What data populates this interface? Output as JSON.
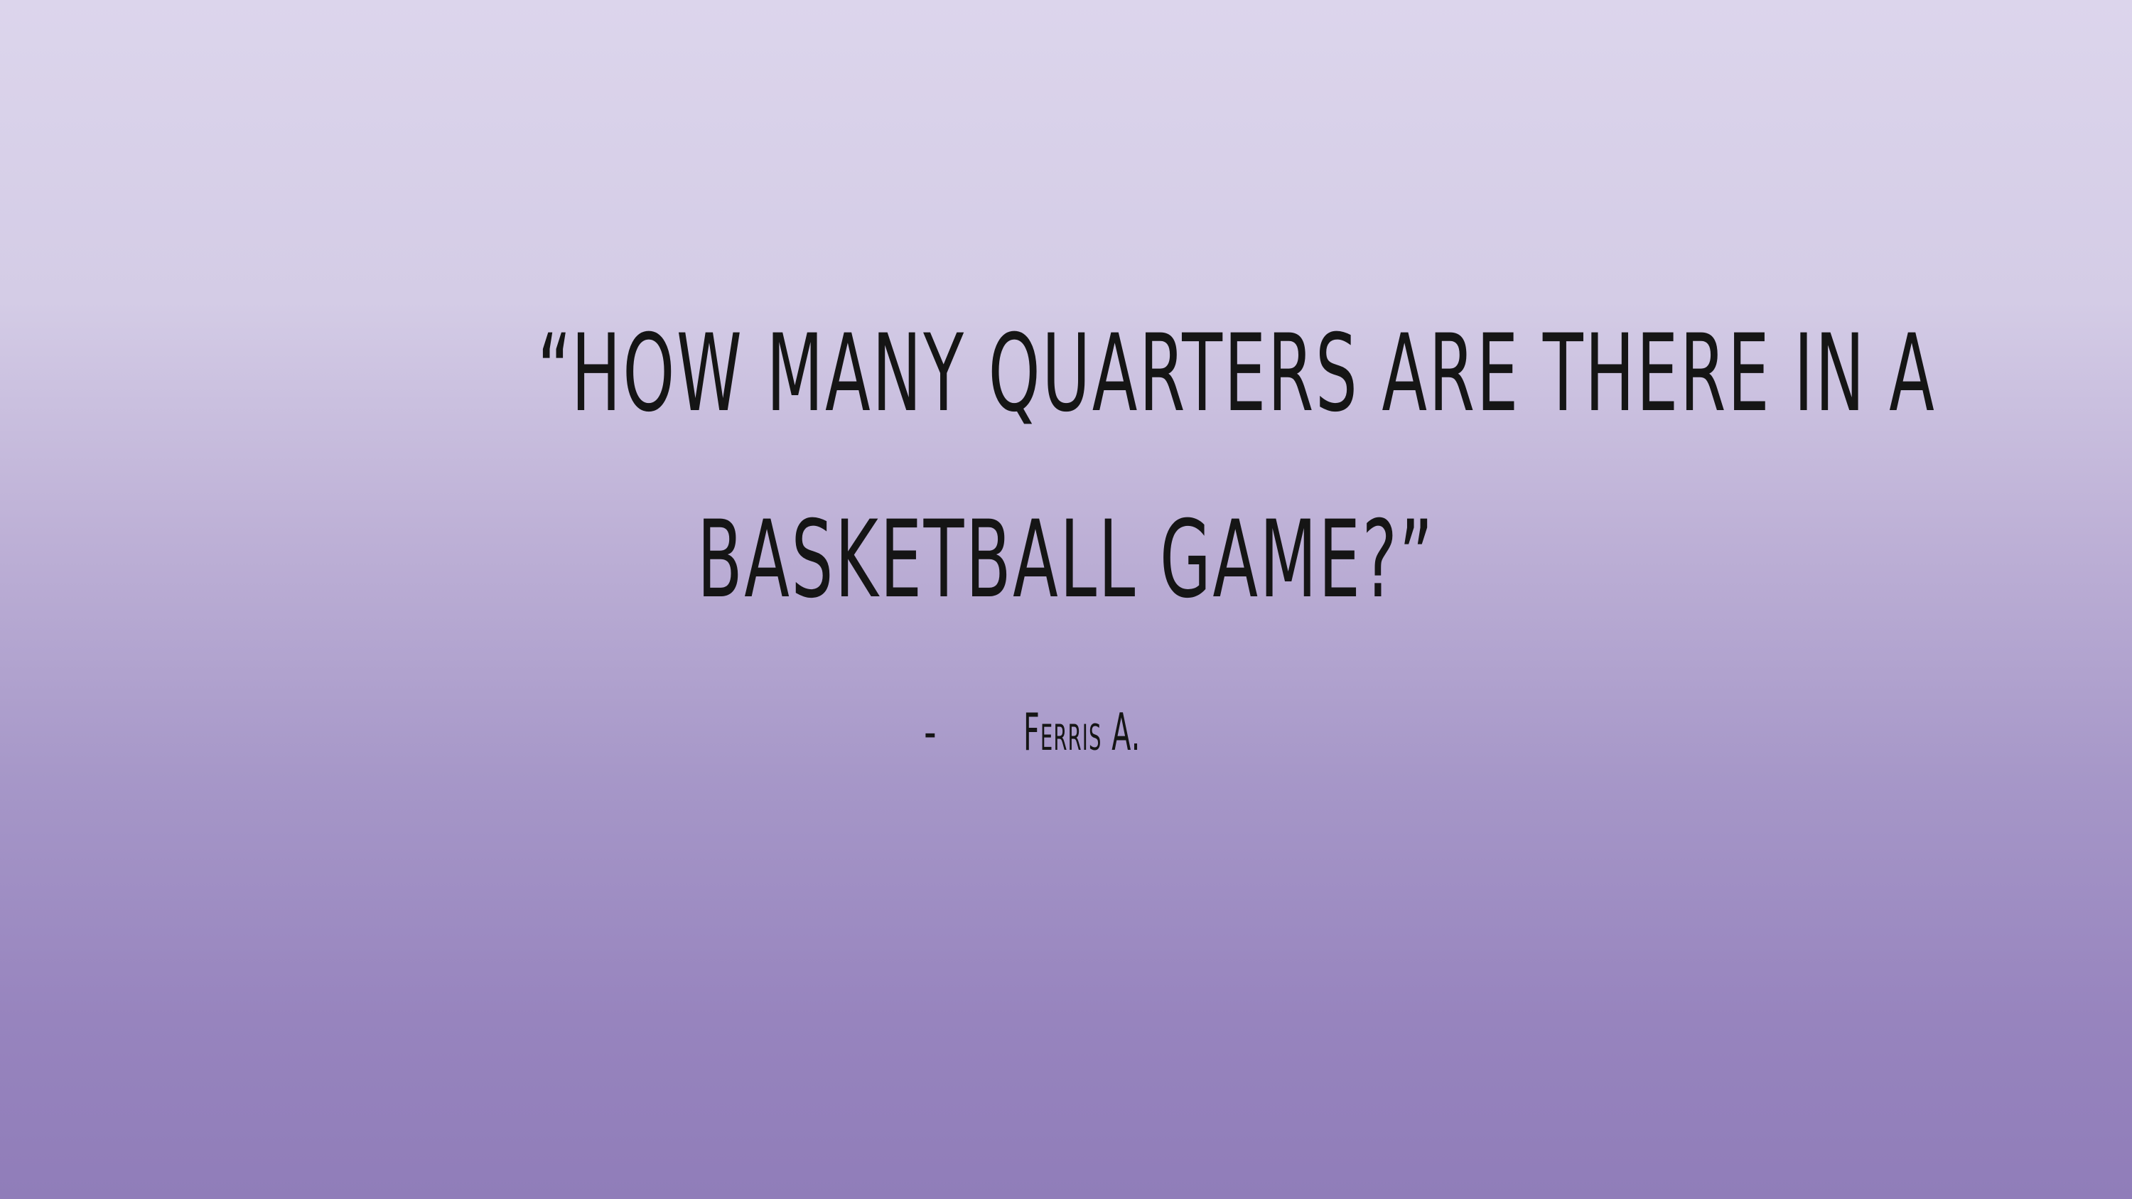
{
  "slide": {
    "quote_line1": "“How many quarters are there in a",
    "quote_line2": "basketball game?”",
    "attribution_dash": "-",
    "author": "Ferris A."
  },
  "colors": {
    "background_top": "#dcd5ec",
    "background_bottom": "#907db9",
    "text": "#151515"
  }
}
